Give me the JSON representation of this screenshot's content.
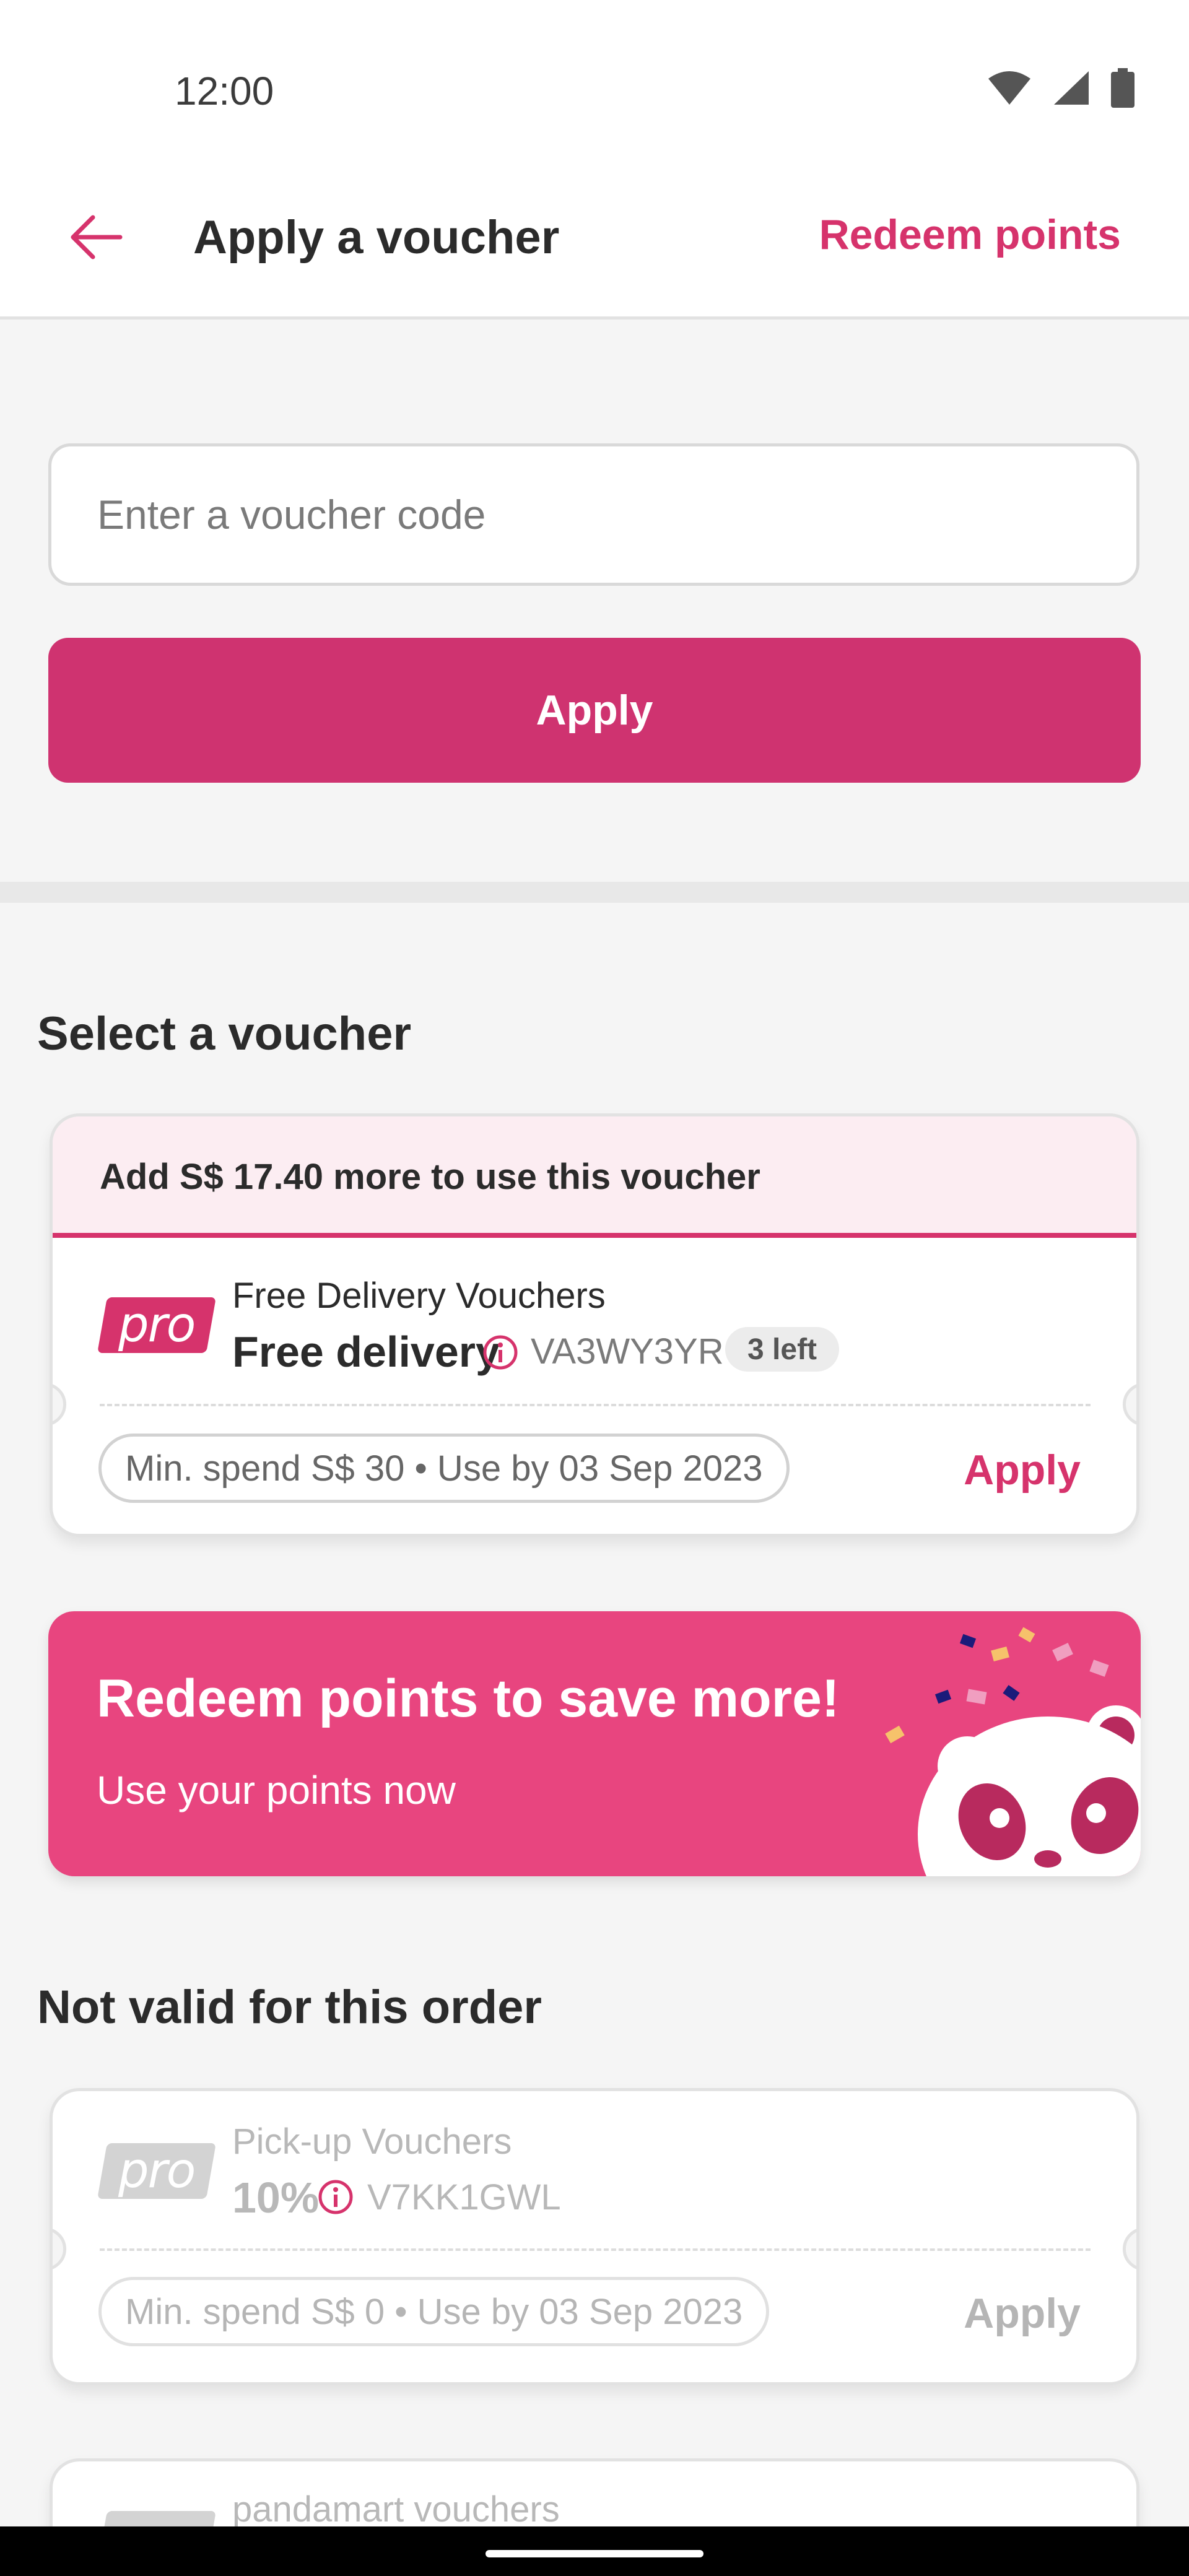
{
  "status_bar": {
    "time": "12:00",
    "icons": [
      "wifi-icon",
      "signal-icon",
      "battery-icon"
    ]
  },
  "app_bar": {
    "back_icon": "arrow-left-icon",
    "title": "Apply a voucher",
    "redeem_label": "Redeem points"
  },
  "code_entry": {
    "placeholder": "Enter a voucher code",
    "value": "",
    "apply_label": "Apply"
  },
  "select_section": {
    "heading": "Select a voucher",
    "voucher": {
      "banner": "Add S$ 17.40 more to use this voucher",
      "logo_text": "pro",
      "category": "Free Delivery Vouchers",
      "value": "Free delivery",
      "code": "VA3WY3YR",
      "badge": "3 left",
      "terms": "Min. spend S$ 30 • Use by 03 Sep 2023",
      "apply_label": "Apply"
    }
  },
  "promo": {
    "title": "Redeem points to save more!",
    "subtitle": "Use your points now",
    "illustration": "panda-confetti-illustration"
  },
  "invalid_section": {
    "heading": "Not valid for this order",
    "vouchers": [
      {
        "logo_text": "pro",
        "category": "Pick-up Vouchers",
        "value": "10%",
        "code": "V7KK1GWL",
        "terms": "Min. spend S$ 0 • Use by 03 Sep 2023",
        "apply_label": "Apply"
      },
      {
        "category": "pandamart vouchers"
      }
    ]
  },
  "colors": {
    "brand": "#d6336c",
    "apply_button": "#cf3370",
    "promo_bg": "#e8457f",
    "banner_bg": "#fcedf2",
    "page_bg": "#f5f5f5"
  }
}
